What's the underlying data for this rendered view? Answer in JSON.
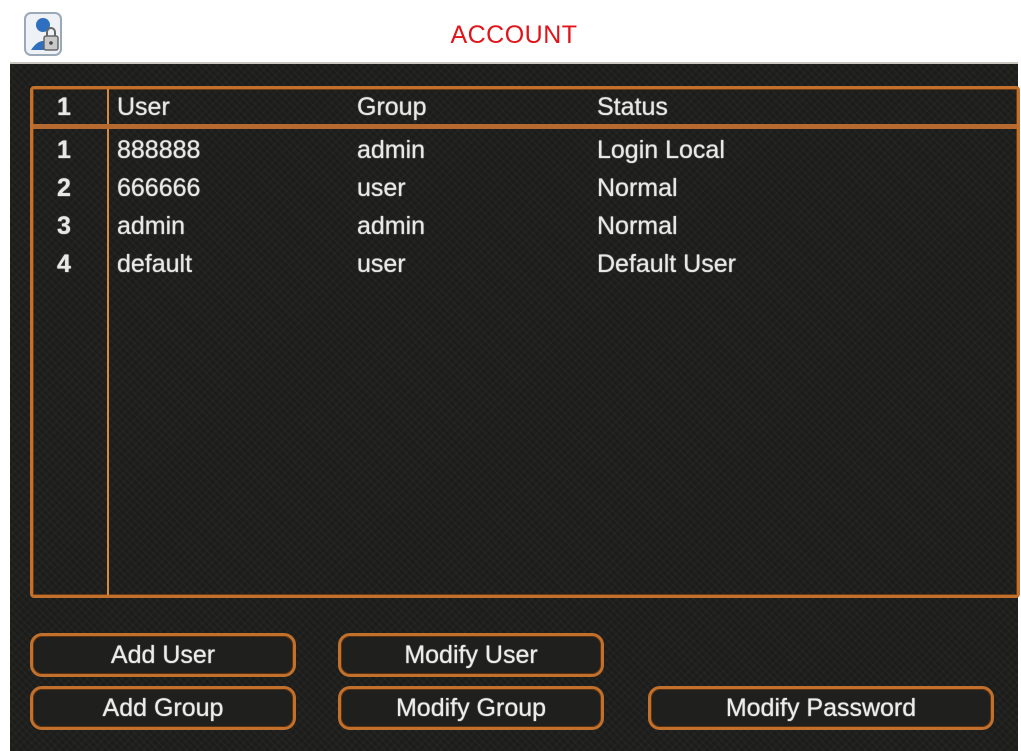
{
  "window": {
    "title": "ACCOUNT",
    "title_color": "#e0141a",
    "accent_color": "#c2712d"
  },
  "title_icon": "user-lock-icon",
  "table": {
    "header": {
      "index": "1",
      "user": "User",
      "group": "Group",
      "status": "Status"
    },
    "rows": [
      {
        "index": "1",
        "user": "888888",
        "group": "admin",
        "status": "Login Local"
      },
      {
        "index": "2",
        "user": "666666",
        "group": "user",
        "status": "Normal"
      },
      {
        "index": "3",
        "user": "admin",
        "group": "admin",
        "status": "Normal"
      },
      {
        "index": "4",
        "user": "default",
        "group": "user",
        "status": "Default User"
      }
    ]
  },
  "buttons": {
    "add_user": "Add User",
    "modify_user": "Modify User",
    "add_group": "Add Group",
    "modify_group": "Modify Group",
    "modify_password": "Modify Password"
  }
}
